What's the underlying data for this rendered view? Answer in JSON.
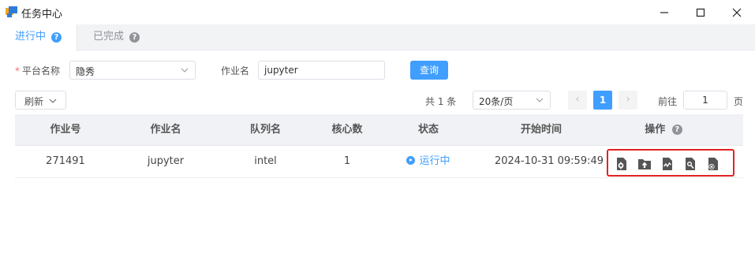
{
  "window": {
    "title": "任务中心",
    "controls": [
      "minimize-icon",
      "maximize-icon",
      "close-icon"
    ]
  },
  "tabs": [
    {
      "label": "进行中",
      "active": true,
      "icon": "help-icon"
    },
    {
      "label": "已完成",
      "active": false,
      "icon": "help-icon"
    }
  ],
  "filters": {
    "platform_label": "平台名称",
    "platform_required_mark": "*",
    "platform_value": "隐秀",
    "jobname_label": "作业名",
    "jobname_value": "jupyter",
    "query_button": "查询"
  },
  "toolbar": {
    "refresh_label": "刷新"
  },
  "pagination": {
    "total_text": "共 1 条",
    "page_size": "20条/页",
    "current_page": "1",
    "goto_label": "前往",
    "goto_value": "1",
    "goto_suffix": "页"
  },
  "table": {
    "columns": [
      "作业号",
      "作业名",
      "队列名",
      "核心数",
      "状态",
      "开始时间",
      "操作"
    ],
    "rows": [
      {
        "job_id": "271491",
        "job_name": "jupyter",
        "queue": "intel",
        "cores": "1",
        "status": "运行中",
        "start_time": "2024-10-31 09:59:49",
        "actions": [
          "file-settings-icon",
          "folder-upload-icon",
          "file-chart-icon",
          "file-search-icon",
          "file-cancel-icon"
        ]
      }
    ]
  },
  "colors": {
    "accent": "#409eff",
    "highlight_border": "#e32222",
    "header_bg": "#f0f2f5",
    "icon_gray": "#555555"
  }
}
